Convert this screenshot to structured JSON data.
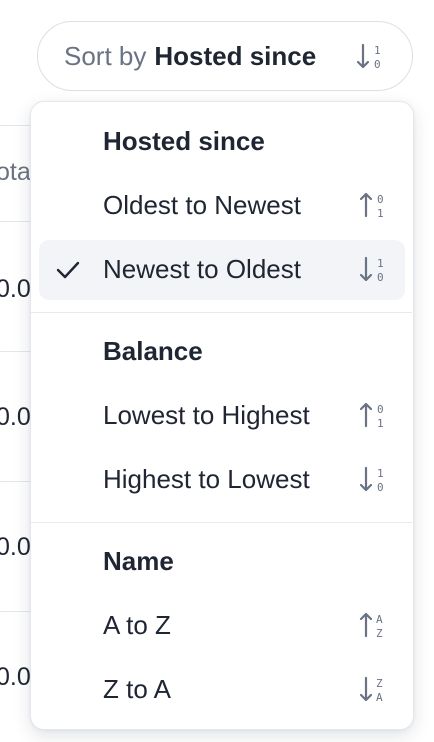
{
  "background": {
    "column_header": "ota",
    "cells": [
      "0.0",
      "0.0",
      "0.0",
      "0.0"
    ]
  },
  "sort": {
    "prefix": "Sort by",
    "value": "Hosted since",
    "icon": "sort-descending-numeric-icon"
  },
  "dropdown": {
    "groups": [
      {
        "title": "Hosted since",
        "items": [
          {
            "label": "Oldest to Newest",
            "icon": "sort-ascending-numeric-icon",
            "selected": false
          },
          {
            "label": "Newest to Oldest",
            "icon": "sort-descending-numeric-icon",
            "selected": true
          }
        ]
      },
      {
        "title": "Balance",
        "items": [
          {
            "label": "Lowest to Highest",
            "icon": "sort-ascending-numeric-icon",
            "selected": false
          },
          {
            "label": "Highest to Lowest",
            "icon": "sort-descending-numeric-icon",
            "selected": false
          }
        ]
      },
      {
        "title": "Name",
        "items": [
          {
            "label": "A to Z",
            "icon": "sort-ascending-alpha-icon",
            "selected": false
          },
          {
            "label": "Z to A",
            "icon": "sort-descending-alpha-icon",
            "selected": false
          }
        ]
      }
    ]
  },
  "colors": {
    "text": "#1f2532",
    "muted": "#697384",
    "selected_bg": "#f2f4f8",
    "border": "#e4e7ec"
  }
}
